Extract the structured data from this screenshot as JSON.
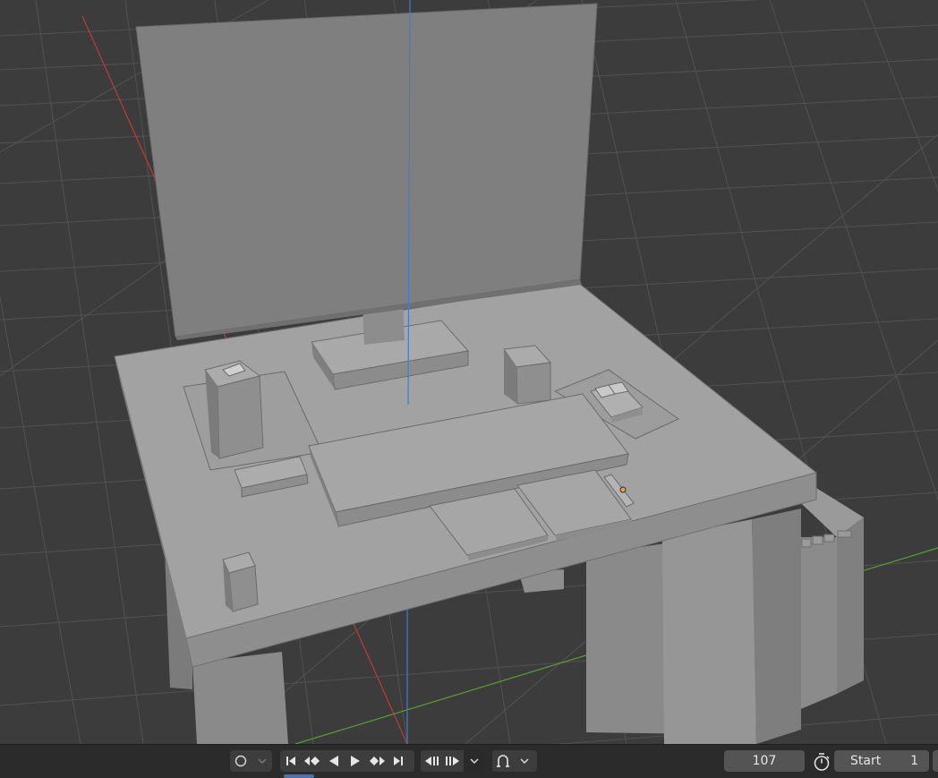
{
  "viewport": {
    "colors": {
      "background": "#3c3c3c",
      "grid": "#525252",
      "x_axis": "#c03a3a",
      "y_axis": "#58a02c",
      "z_axis": "#3f7dd2",
      "model_light": "#a3a3a3",
      "model_mid": "#8c8c8c",
      "model_dark": "#757575",
      "origin": "#f0a03c"
    }
  },
  "timeline": {
    "keying_icon": "circle-icon",
    "playback": [
      "jump-start-icon",
      "prev-keyframe-icon",
      "play-reverse-icon",
      "play-icon",
      "next-keyframe-icon",
      "jump-end-icon"
    ],
    "current_frame": "107",
    "start_label": "Start",
    "start_value": "1"
  }
}
